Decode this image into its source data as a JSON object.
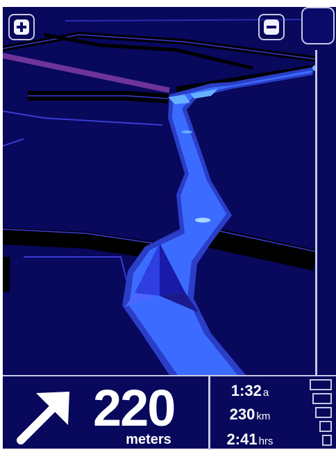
{
  "map": {
    "colors": {
      "background": "#08085c",
      "road_dark": "#000000",
      "road_outline": "#3a3ad8",
      "route_fill": "#3b6cff",
      "route_edge": "#2a3ec8",
      "route_highlight": "#66b0ff",
      "arrow_fill": "#2e3ee0",
      "arrow_shadow": "#1a1aa8",
      "purple_road": "#7a3aa0"
    },
    "zoom_in_icon": "plus-icon",
    "zoom_out_icon": "minus-icon"
  },
  "instruction": {
    "turn_icon": "arrow-up-right-icon",
    "distance": "220",
    "unit": "meters"
  },
  "trip_info": {
    "eta": {
      "value": "1:32",
      "unit": "a"
    },
    "remaining_distance": {
      "value": "230",
      "unit": "km"
    },
    "remaining_time": {
      "value": "2:41",
      "unit": "hrs"
    }
  },
  "status": {
    "signal_icon": "signal-strength-icon"
  },
  "theme": {
    "panel_border": "#c8c8e6",
    "text": "#ffffff"
  }
}
